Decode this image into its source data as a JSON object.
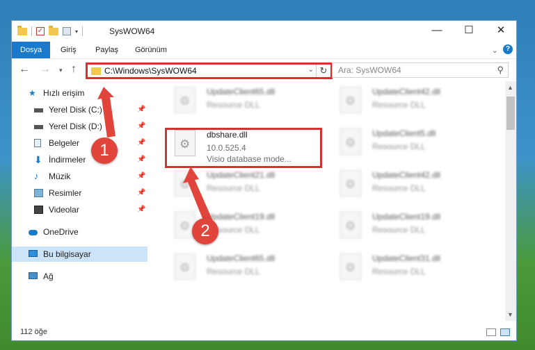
{
  "window": {
    "title": "SysWOW64"
  },
  "ribbon": {
    "tabs": [
      "Dosya",
      "Giriş",
      "Paylaş",
      "Görünüm"
    ]
  },
  "address": {
    "path": "C:\\Windows\\SysWOW64"
  },
  "search": {
    "placeholder": "Ara: SysWOW64"
  },
  "nav": {
    "quick_access": "Hızlı erişim",
    "items": [
      {
        "label": "Yerel Disk (C:)",
        "icon": "drive-icon",
        "pinned": true
      },
      {
        "label": "Yerel Disk (D:)",
        "icon": "drive-icon",
        "pinned": true
      },
      {
        "label": "Belgeler",
        "icon": "documents-icon",
        "pinned": true
      },
      {
        "label": "İndirmeler",
        "icon": "downloads-icon",
        "pinned": true
      },
      {
        "label": "Müzik",
        "icon": "music-icon",
        "pinned": true
      },
      {
        "label": "Resimler",
        "icon": "pictures-icon",
        "pinned": true
      },
      {
        "label": "Videolar",
        "icon": "videos-icon",
        "pinned": true
      }
    ],
    "onedrive": "OneDrive",
    "this_pc": "Bu bilgisayar",
    "network": "Ağ"
  },
  "files": [
    {
      "name": "UpdateClient65.dll",
      "line2": "Resource DLL",
      "line3": "",
      "blurred": true
    },
    {
      "name": "UpdateClient42.dll",
      "line2": "Resource DLL",
      "line3": "",
      "blurred": true
    },
    {
      "name": "dbshare.dll",
      "line2": "10.0.525.4",
      "line3": "Visio database mode...",
      "blurred": false
    },
    {
      "name": "UpdateClient5.dll",
      "line2": "Resource DLL",
      "line3": "",
      "blurred": true
    },
    {
      "name": "UpdateClient21.dll",
      "line2": "Resource DLL",
      "line3": "",
      "blurred": true
    },
    {
      "name": "UpdateClient42.dll",
      "line2": "Resource DLL",
      "line3": "",
      "blurred": true
    },
    {
      "name": "UpdateClient19.dll",
      "line2": "Resource DLL",
      "line3": "",
      "blurred": true
    },
    {
      "name": "UpdateClient19.dll",
      "line2": "Resource DLL",
      "line3": "",
      "blurred": true
    },
    {
      "name": "UpdateClient65.dll",
      "line2": "Resource DLL",
      "line3": "",
      "blurred": true
    },
    {
      "name": "UpdateClient31.dll",
      "line2": "Resource DLL",
      "line3": "",
      "blurred": true
    }
  ],
  "status": {
    "count": "112 öğe"
  },
  "callouts": [
    "1",
    "2"
  ],
  "colors": {
    "accent": "#1979ca",
    "highlight": "#d9302f",
    "callout": "#e0443a"
  }
}
